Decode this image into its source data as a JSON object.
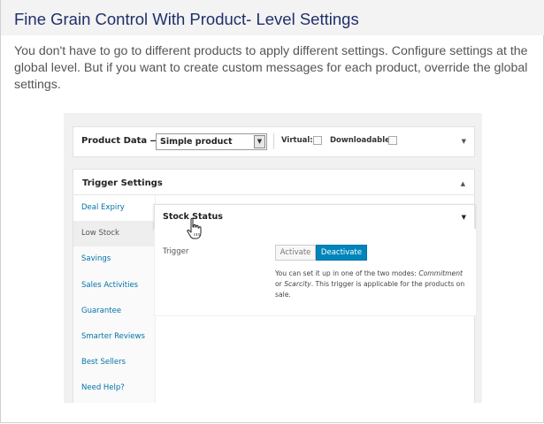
{
  "header": {
    "title": "Fine Grain Control With Product- Level Settings",
    "description": "You don't have to go to different products to apply different settings. Configure settings at the global level. But if you want to create custom messages for each product, override the global settings."
  },
  "product_data": {
    "label": "Product Data —",
    "selected_type": "Simple product",
    "virtual_label": "Virtual:",
    "downloadable_label": "Downloadable:"
  },
  "trigger_settings": {
    "title": "Trigger Settings",
    "tabs": [
      {
        "label": "Deal Expiry"
      },
      {
        "label": "Low Stock"
      },
      {
        "label": "Savings"
      },
      {
        "label": "Sales Activities"
      },
      {
        "label": "Guarantee"
      },
      {
        "label": "Smarter Reviews"
      },
      {
        "label": "Best Sellers"
      },
      {
        "label": "Need Help?"
      }
    ]
  },
  "stock_status": {
    "title": "Stock Status",
    "field_label": "Trigger",
    "activate_label": "Activate",
    "deactivate_label": "Deactivate",
    "help_prefix": "You can set it up in one of the two modes: ",
    "help_mode1": "Commitment",
    "help_or": " or ",
    "help_mode2": "Scarcity",
    "help_suffix": ". This trigger is applicable for the products on sale."
  },
  "colors": {
    "title": "#1f2f6b",
    "link": "#0073aa",
    "primary_button": "#0085ba"
  }
}
